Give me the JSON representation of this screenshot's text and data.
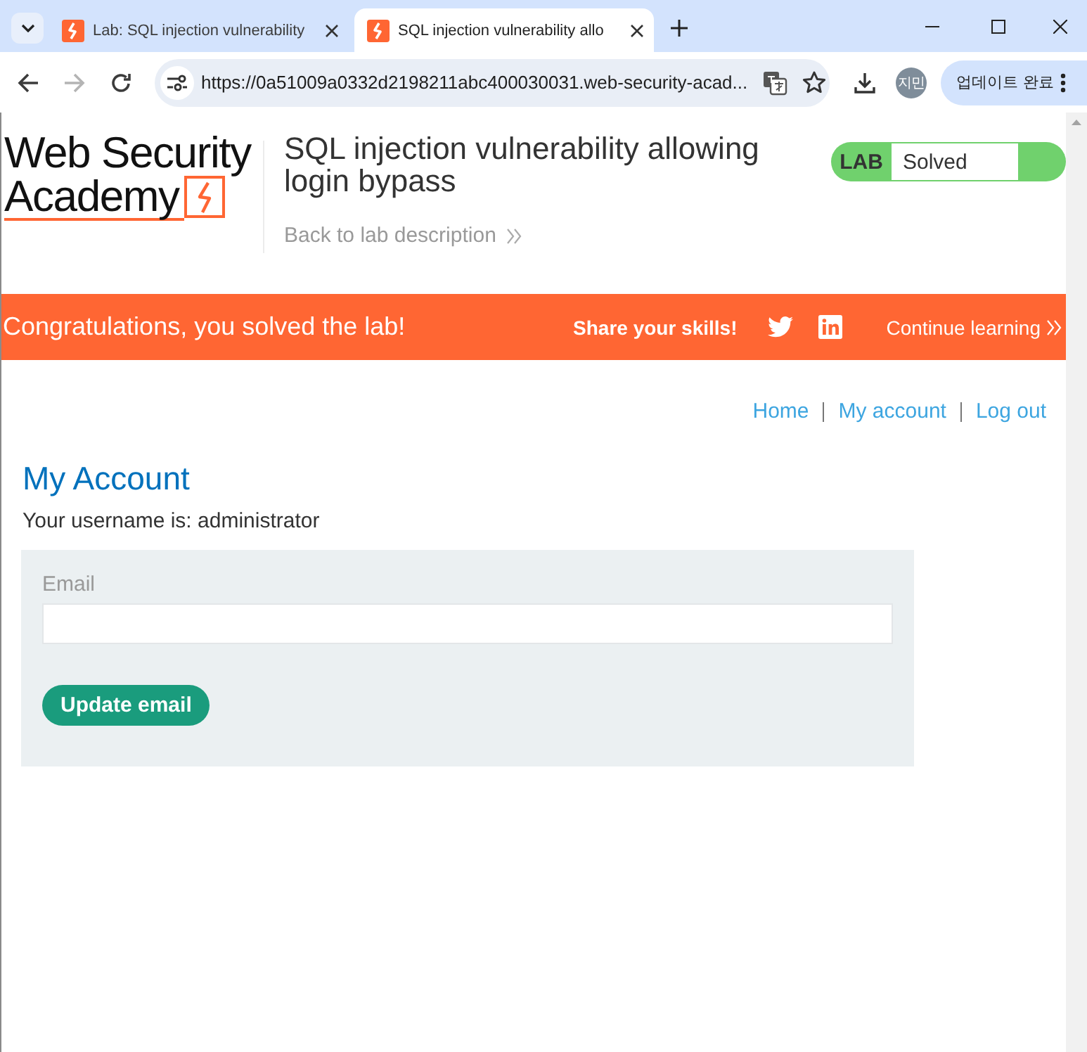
{
  "browser": {
    "tabs": [
      {
        "title": "Lab: SQL injection vulnerability",
        "selected": false
      },
      {
        "title": "SQL injection vulnerability allo",
        "selected": true
      }
    ],
    "forward_enabled": false,
    "address": "https://0a51009a0332d2198211abc400030031.web-security-acad...",
    "profile_initials": "지민",
    "update_button": "업데이트 완료"
  },
  "header": {
    "logo": [
      "Web Security",
      "Academy"
    ],
    "title": "SQL injection vulnerability allowing login bypass",
    "back_link": "Back to lab description",
    "status": {
      "label": "LAB",
      "text": "Solved",
      "solved": true
    }
  },
  "banner": {
    "message": "Congratulations, you solved the lab!",
    "share_label": "Share your skills!",
    "continue_link": "Continue learning"
  },
  "nav": [
    {
      "label": "Home"
    },
    {
      "label": "My account"
    },
    {
      "label": "Log out"
    }
  ],
  "account": {
    "heading": "My Account",
    "username_text": "Your username is: administrator",
    "email_label": "Email",
    "submit_button": "Update email"
  }
}
